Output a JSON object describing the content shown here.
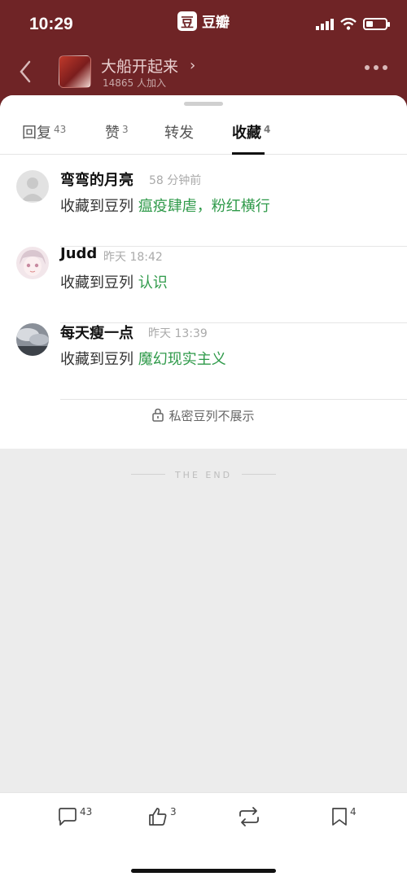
{
  "status": {
    "time": "10:29",
    "app_logo": "豆",
    "app_name": "豆瓣"
  },
  "nav": {
    "group_title": "大船开起来",
    "group_sub": "14865 人加入"
  },
  "tabs": [
    {
      "label": "回复",
      "count": "43"
    },
    {
      "label": "赞",
      "count": "3"
    },
    {
      "label": "转发",
      "count": ""
    },
    {
      "label": "收藏",
      "count": "4"
    }
  ],
  "active_tab": "收藏",
  "items": [
    {
      "name": "弯弯的月亮",
      "time": "58 分钟前",
      "action": "收藏到豆列",
      "doulist": "瘟疫肆虐，粉红横行"
    },
    {
      "name": "Judd",
      "time": "昨天 18:42",
      "action": "收藏到豆列",
      "doulist": "认识"
    },
    {
      "name": "每天瘦一点",
      "time": "昨天 13:39",
      "action": "收藏到豆列",
      "doulist": "魔幻现实主义"
    }
  ],
  "private_note": "私密豆列不展示",
  "end_text": "THE END",
  "bottom_bar": {
    "comment_count": "43",
    "like_count": "3",
    "collect_count": "4"
  },
  "colors": {
    "header_bg": "#6f2426",
    "link_green": "#2f9a4a"
  }
}
